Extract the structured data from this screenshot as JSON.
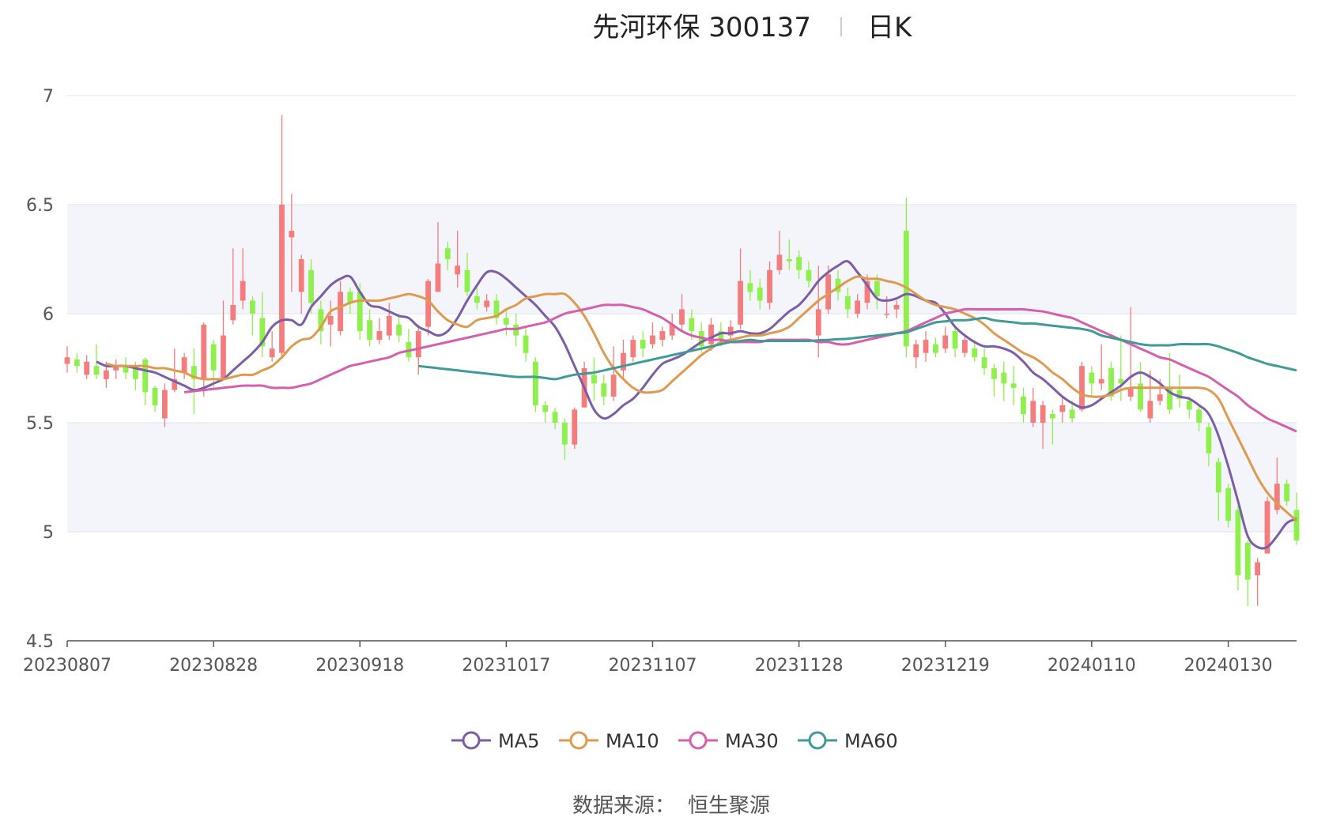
{
  "header": {
    "title": "先河环保 300137",
    "period": "日K"
  },
  "footer": {
    "source_label": "数据来源：",
    "source_name": "恒生聚源"
  },
  "colors": {
    "up": "#f47c7c",
    "down": "#8ef04a",
    "ma5": "#7b5ea7",
    "ma10": "#e09a4e",
    "ma30": "#d65fad",
    "ma60": "#3f9a98",
    "band": "#f3f5fa",
    "grid": "#dde3ee",
    "axis": "#555555"
  },
  "chart_data": {
    "type": "candlestick",
    "ylim": [
      4.5,
      7
    ],
    "y_ticks": [
      "4.5",
      "5",
      "5.5",
      "6",
      "6.5",
      "7"
    ],
    "x_ticks": [
      {
        "index": 0,
        "label": "20230807"
      },
      {
        "index": 15,
        "label": "20230828"
      },
      {
        "index": 30,
        "label": "20230918"
      },
      {
        "index": 45,
        "label": "20231017"
      },
      {
        "index": 60,
        "label": "20231107"
      },
      {
        "index": 75,
        "label": "20231128"
      },
      {
        "index": 90,
        "label": "20231219"
      },
      {
        "index": 105,
        "label": "20240110"
      },
      {
        "index": 119,
        "label": "20240130"
      }
    ],
    "grid": true,
    "legend_position": "bottom",
    "legend": [
      "MA5",
      "MA10",
      "MA30",
      "MA60"
    ],
    "candles": [
      [
        5.77,
        5.8,
        5.73,
        5.85
      ],
      [
        5.79,
        5.76,
        5.73,
        5.82
      ],
      [
        5.72,
        5.78,
        5.7,
        5.81
      ],
      [
        5.76,
        5.72,
        5.7,
        5.86
      ],
      [
        5.7,
        5.74,
        5.66,
        5.78
      ],
      [
        5.74,
        5.76,
        5.7,
        5.79
      ],
      [
        5.76,
        5.73,
        5.7,
        5.8
      ],
      [
        5.75,
        5.7,
        5.65,
        5.78
      ],
      [
        5.79,
        5.64,
        5.58,
        5.8
      ],
      [
        5.66,
        5.58,
        5.55,
        5.67
      ],
      [
        5.52,
        5.65,
        5.48,
        5.68
      ],
      [
        5.65,
        5.7,
        5.64,
        5.84
      ],
      [
        5.73,
        5.8,
        5.7,
        5.82
      ],
      [
        5.76,
        5.7,
        5.54,
        5.84
      ],
      [
        5.7,
        5.95,
        5.62,
        5.96
      ],
      [
        5.86,
        5.74,
        5.65,
        5.88
      ],
      [
        5.7,
        5.9,
        5.7,
        6.06
      ],
      [
        5.97,
        6.04,
        5.95,
        6.3
      ],
      [
        6.06,
        6.15,
        6.02,
        6.3
      ],
      [
        6.06,
        6.0,
        5.9,
        6.08
      ],
      [
        5.98,
        5.85,
        5.8,
        6.1
      ],
      [
        5.8,
        5.84,
        5.78,
        5.92
      ],
      [
        5.82,
        6.5,
        5.8,
        6.91
      ],
      [
        6.35,
        6.38,
        6.1,
        6.55
      ],
      [
        6.1,
        6.25,
        6.0,
        6.27
      ],
      [
        6.2,
        6.05,
        6.0,
        6.25
      ],
      [
        6.02,
        5.92,
        5.86,
        6.06
      ],
      [
        5.95,
        5.99,
        5.85,
        6.06
      ],
      [
        5.92,
        6.1,
        5.9,
        6.15
      ],
      [
        6.1,
        6.05,
        6.0,
        6.12
      ],
      [
        6.1,
        5.92,
        5.88,
        6.14
      ],
      [
        5.97,
        5.88,
        5.85,
        6.02
      ],
      [
        5.88,
        5.92,
        5.86,
        5.98
      ],
      [
        5.9,
        5.99,
        5.88,
        6.05
      ],
      [
        5.95,
        5.9,
        5.87,
        5.99
      ],
      [
        5.87,
        5.8,
        5.78,
        5.93
      ],
      [
        5.8,
        5.92,
        5.72,
        5.95
      ],
      [
        5.94,
        6.15,
        5.9,
        6.16
      ],
      [
        6.1,
        6.23,
        6.1,
        6.42
      ],
      [
        6.3,
        6.25,
        6.2,
        6.33
      ],
      [
        6.18,
        6.22,
        6.12,
        6.38
      ],
      [
        6.2,
        6.1,
        6.08,
        6.28
      ],
      [
        6.08,
        6.05,
        6.02,
        6.12
      ],
      [
        6.03,
        6.06,
        6.01,
        6.09
      ],
      [
        6.06,
        5.98,
        5.95,
        6.09
      ],
      [
        5.98,
        5.95,
        5.9,
        6.02
      ],
      [
        5.95,
        5.9,
        5.85,
        6.0
      ],
      [
        5.9,
        5.82,
        5.78,
        5.94
      ],
      [
        5.78,
        5.58,
        5.55,
        5.8
      ],
      [
        5.58,
        5.55,
        5.5,
        5.6
      ],
      [
        5.55,
        5.5,
        5.47,
        5.57
      ],
      [
        5.5,
        5.4,
        5.33,
        5.52
      ],
      [
        5.4,
        5.56,
        5.38,
        5.57
      ],
      [
        5.57,
        5.75,
        5.57,
        5.78
      ],
      [
        5.72,
        5.68,
        5.6,
        5.8
      ],
      [
        5.68,
        5.62,
        5.58,
        5.72
      ],
      [
        5.62,
        5.72,
        5.6,
        5.85
      ],
      [
        5.74,
        5.82,
        5.7,
        5.88
      ],
      [
        5.8,
        5.88,
        5.78,
        5.9
      ],
      [
        5.88,
        5.84,
        5.8,
        5.92
      ],
      [
        5.86,
        5.9,
        5.84,
        5.96
      ],
      [
        5.88,
        5.92,
        5.85,
        5.94
      ],
      [
        5.9,
        5.95,
        5.88,
        6.0
      ],
      [
        5.95,
        6.02,
        5.92,
        6.09
      ],
      [
        5.98,
        5.92,
        5.88,
        6.02
      ],
      [
        5.92,
        5.85,
        5.82,
        5.96
      ],
      [
        5.86,
        5.95,
        5.83,
        5.98
      ],
      [
        5.92,
        5.88,
        5.85,
        5.96
      ],
      [
        5.9,
        5.94,
        5.88,
        5.97
      ],
      [
        5.95,
        6.15,
        5.93,
        6.3
      ],
      [
        6.14,
        6.1,
        6.06,
        6.2
      ],
      [
        6.12,
        6.06,
        6.02,
        6.16
      ],
      [
        6.05,
        6.2,
        6.02,
        6.24
      ],
      [
        6.2,
        6.27,
        6.18,
        6.38
      ],
      [
        6.25,
        6.24,
        6.2,
        6.34
      ],
      [
        6.26,
        6.2,
        6.16,
        6.29
      ],
      [
        6.2,
        6.15,
        6.12,
        6.24
      ],
      [
        5.9,
        6.02,
        5.8,
        6.22
      ],
      [
        6.02,
        6.18,
        6.0,
        6.22
      ],
      [
        6.16,
        6.1,
        6.06,
        6.2
      ],
      [
        6.08,
        6.02,
        5.98,
        6.12
      ],
      [
        6.0,
        6.06,
        5.98,
        6.09
      ],
      [
        6.05,
        6.15,
        6.02,
        6.18
      ],
      [
        6.15,
        6.08,
        6.02,
        6.18
      ],
      [
        6.0,
        6.0,
        5.98,
        6.08
      ],
      [
        6.02,
        6.04,
        5.98,
        6.06
      ],
      [
        6.38,
        5.85,
        5.8,
        6.53
      ],
      [
        5.8,
        5.86,
        5.75,
        5.88
      ],
      [
        5.82,
        5.88,
        5.78,
        5.92
      ],
      [
        5.86,
        5.82,
        5.8,
        5.89
      ],
      [
        5.84,
        5.9,
        5.82,
        5.94
      ],
      [
        5.92,
        5.84,
        5.8,
        5.94
      ],
      [
        5.82,
        5.88,
        5.8,
        5.9
      ],
      [
        5.84,
        5.8,
        5.78,
        5.88
      ],
      [
        5.8,
        5.75,
        5.72,
        5.84
      ],
      [
        5.75,
        5.7,
        5.62,
        5.77
      ],
      [
        5.73,
        5.68,
        5.6,
        5.78
      ],
      [
        5.68,
        5.66,
        5.58,
        5.76
      ],
      [
        5.62,
        5.54,
        5.5,
        5.66
      ],
      [
        5.5,
        5.6,
        5.48,
        5.66
      ],
      [
        5.5,
        5.58,
        5.38,
        5.6
      ],
      [
        5.54,
        5.52,
        5.4,
        5.56
      ],
      [
        5.55,
        5.58,
        5.5,
        5.62
      ],
      [
        5.56,
        5.52,
        5.5,
        5.6
      ],
      [
        5.56,
        5.76,
        5.55,
        5.78
      ],
      [
        5.73,
        5.68,
        5.62,
        5.76
      ],
      [
        5.68,
        5.7,
        5.65,
        5.86
      ],
      [
        5.75,
        5.62,
        5.6,
        5.78
      ],
      [
        5.7,
        5.68,
        5.6,
        5.9
      ],
      [
        5.62,
        5.66,
        5.6,
        6.03
      ],
      [
        5.68,
        5.56,
        5.55,
        5.78
      ],
      [
        5.52,
        5.6,
        5.5,
        5.74
      ],
      [
        5.6,
        5.63,
        5.58,
        5.7
      ],
      [
        5.66,
        5.56,
        5.54,
        5.82
      ],
      [
        5.65,
        5.61,
        5.57,
        5.72
      ],
      [
        5.6,
        5.56,
        5.52,
        5.62
      ],
      [
        5.56,
        5.5,
        5.46,
        5.58
      ],
      [
        5.48,
        5.36,
        5.3,
        5.5
      ],
      [
        5.32,
        5.18,
        5.05,
        5.34
      ],
      [
        5.2,
        5.05,
        5.02,
        5.22
      ]
    ],
    "candles_tail": [
      [
        5.1,
        4.8,
        4.73,
        5.12
      ],
      [
        4.95,
        4.78,
        4.66,
        4.96
      ],
      [
        4.8,
        4.86,
        4.66,
        4.88
      ],
      [
        4.9,
        5.14,
        4.9,
        5.16
      ],
      [
        5.1,
        5.22,
        5.08,
        5.34
      ],
      [
        5.22,
        5.14,
        5.12,
        5.24
      ],
      [
        5.1,
        4.96,
        4.94,
        5.18
      ]
    ],
    "series": [
      {
        "name": "MA5",
        "values": [
          5.78,
          5.76,
          5.76,
          5.76,
          5.75,
          5.74,
          5.73,
          5.71,
          5.69,
          5.67,
          5.65,
          5.66,
          5.68,
          5.7,
          5.74,
          5.78,
          5.82,
          5.87,
          5.94,
          5.97,
          5.97,
          5.95,
          6.03,
          6.08,
          6.13,
          6.16,
          6.17,
          6.1,
          6.04,
          6.03,
          6.01,
          5.99,
          5.98,
          5.94,
          5.92,
          5.9,
          5.92,
          5.98,
          6.06,
          6.13,
          6.19,
          6.19,
          6.16,
          6.12,
          6.08,
          6.04,
          5.99,
          5.94,
          5.86,
          5.76,
          5.66,
          5.56,
          5.52,
          5.54,
          5.58,
          5.61,
          5.66,
          5.72,
          5.77,
          5.79,
          5.81,
          5.84,
          5.87,
          5.89,
          5.91,
          5.91,
          5.92,
          5.91,
          5.91,
          5.93,
          5.97,
          6.01,
          6.04,
          6.09,
          6.15,
          6.19,
          6.22,
          6.24,
          6.19,
          6.13,
          6.07,
          6.06,
          6.07,
          6.09,
          6.08,
          6.06,
          6.05,
          6.0,
          5.94,
          5.9,
          5.87,
          5.85,
          5.85,
          5.84,
          5.82,
          5.78,
          5.73,
          5.7,
          5.66,
          5.62,
          5.59,
          5.57,
          5.58,
          5.61,
          5.64,
          5.67,
          5.71,
          5.73,
          5.71,
          5.68,
          5.64,
          5.62,
          5.61,
          5.58,
          5.54,
          5.44,
          5.3,
          5.14,
          4.98,
          4.93,
          4.93,
          4.98,
          5.04,
          5.06
        ]
      },
      {
        "name": "MA10",
        "values": [
          5.77,
          5.76,
          5.76,
          5.76,
          5.76,
          5.75,
          5.75,
          5.74,
          5.73,
          5.71,
          5.7,
          5.7,
          5.7,
          5.71,
          5.72,
          5.72,
          5.74,
          5.76,
          5.8,
          5.85,
          5.88,
          5.89,
          5.94,
          6.01,
          6.03,
          6.05,
          6.06,
          6.06,
          6.06,
          6.07,
          6.08,
          6.09,
          6.08,
          6.06,
          6.01,
          5.97,
          5.95,
          5.94,
          5.97,
          5.98,
          5.99,
          6.02,
          6.04,
          6.07,
          6.08,
          6.09,
          6.09,
          6.09,
          6.05,
          5.99,
          5.91,
          5.82,
          5.75,
          5.7,
          5.66,
          5.64,
          5.64,
          5.65,
          5.69,
          5.73,
          5.77,
          5.81,
          5.84,
          5.87,
          5.88,
          5.89,
          5.9,
          5.9,
          5.91,
          5.92,
          5.94,
          5.98,
          6.02,
          6.06,
          6.09,
          6.12,
          6.15,
          6.17,
          6.16,
          6.16,
          6.15,
          6.14,
          6.12,
          6.09,
          6.06,
          6.04,
          6.03,
          6.02,
          6.0,
          5.98,
          5.95,
          5.91,
          5.88,
          5.85,
          5.82,
          5.8,
          5.77,
          5.73,
          5.7,
          5.66,
          5.63,
          5.62,
          5.62,
          5.63,
          5.65,
          5.66,
          5.66,
          5.66,
          5.66,
          5.66,
          5.66,
          5.66,
          5.66,
          5.65,
          5.61,
          5.52,
          5.43,
          5.34,
          5.25,
          5.18,
          5.13,
          5.09,
          5.05
        ]
      },
      {
        "name": "MA30",
        "values": [
          5.64,
          5.645,
          5.65,
          5.655,
          5.66,
          5.665,
          5.67,
          5.67,
          5.67,
          5.66,
          5.66,
          5.66,
          5.67,
          5.68,
          5.7,
          5.72,
          5.74,
          5.76,
          5.77,
          5.78,
          5.79,
          5.8,
          5.82,
          5.83,
          5.84,
          5.85,
          5.86,
          5.87,
          5.88,
          5.89,
          5.9,
          5.91,
          5.92,
          5.93,
          5.93,
          5.94,
          5.95,
          5.96,
          5.98,
          6.0,
          6.01,
          6.02,
          6.03,
          6.04,
          6.04,
          6.04,
          6.03,
          6.02,
          6.0,
          5.98,
          5.95,
          5.92,
          5.9,
          5.89,
          5.88,
          5.88,
          5.87,
          5.87,
          5.87,
          5.87,
          5.88,
          5.88,
          5.88,
          5.88,
          5.88,
          5.87,
          5.87,
          5.86,
          5.86,
          5.87,
          5.88,
          5.89,
          5.9,
          5.91,
          5.92,
          5.94,
          5.96,
          5.98,
          6.0,
          6.01,
          6.02,
          6.02,
          6.02,
          6.02,
          6.02,
          6.02,
          6.02,
          6.015,
          6.01,
          6.0,
          5.99,
          5.98,
          5.96,
          5.94,
          5.92,
          5.9,
          5.88,
          5.86,
          5.84,
          5.82,
          5.8,
          5.79,
          5.77,
          5.75,
          5.73,
          5.71,
          5.68,
          5.65,
          5.62,
          5.58,
          5.55,
          5.52,
          5.5,
          5.48,
          5.46
        ]
      },
      {
        "name": "MA60",
        "values": [
          5.76,
          5.755,
          5.75,
          5.745,
          5.74,
          5.735,
          5.73,
          5.725,
          5.72,
          5.715,
          5.71,
          5.71,
          5.71,
          5.705,
          5.7,
          5.71,
          5.72,
          5.725,
          5.73,
          5.74,
          5.75,
          5.76,
          5.77,
          5.78,
          5.79,
          5.8,
          5.81,
          5.82,
          5.83,
          5.84,
          5.85,
          5.86,
          5.87,
          5.875,
          5.88,
          5.875,
          5.875,
          5.875,
          5.875,
          5.875,
          5.875,
          5.878,
          5.88,
          5.883,
          5.885,
          5.89,
          5.895,
          5.9,
          5.905,
          5.91,
          5.915,
          5.93,
          5.945,
          5.96,
          5.965,
          5.97,
          5.97,
          5.975,
          5.98,
          5.97,
          5.965,
          5.96,
          5.955,
          5.955,
          5.95,
          5.945,
          5.94,
          5.935,
          5.93,
          5.92,
          5.9,
          5.89,
          5.88,
          5.87,
          5.86,
          5.855,
          5.855,
          5.855,
          5.86,
          5.86,
          5.86,
          5.86,
          5.85,
          5.835,
          5.82,
          5.8,
          5.785,
          5.77,
          5.76,
          5.75,
          5.74
        ]
      }
    ]
  }
}
